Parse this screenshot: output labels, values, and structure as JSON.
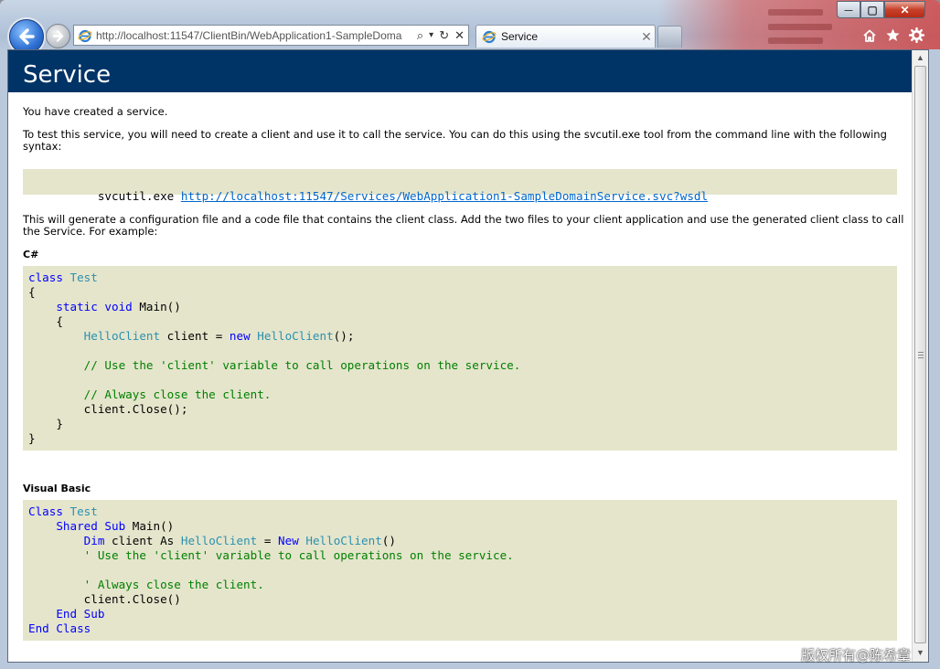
{
  "browser": {
    "address_url": "http://localhost:11547/ClientBin/WebApplication1-SampleDoma",
    "tab_title": "Service",
    "tab_close": "✕",
    "search_glyph": "⌕",
    "dropdown_glyph": "▾",
    "refresh_glyph": "↻",
    "stop_glyph": "✕"
  },
  "window_controls": {
    "minimize": "—",
    "maximize": "▢",
    "close": "✕"
  },
  "icons": {
    "back": "back-arrow-icon",
    "forward": "forward-arrow-icon",
    "home": "home-icon",
    "favorites": "favorites-star-icon",
    "tools": "tools-gear-icon",
    "page": "ie-page-icon"
  },
  "page": {
    "heading": "Service",
    "intro": "You have created a service.",
    "instructions": "To test this service, you will need to create a client and use it to call the service. You can do this using the svcutil.exe tool from the command line with the following syntax:",
    "svcutil_cmd": "svcutil.exe",
    "wsdl_url": "http://localhost:11547/Services/WebApplication1-SampleDomainService.svc?wsdl",
    "generate_note": "This will generate a configuration file and a code file that contains the client class. Add the two files to your client application and use the generated client class to call the Service. For example:",
    "csharp_label": "C#",
    "vb_label": "Visual Basic"
  },
  "csharp": {
    "l1_kw": "class",
    "l1_ty": "Test",
    "l2": "{",
    "l3_kw": "static void",
    "l3_rest": "Main()",
    "l4": "{",
    "l5_ty1": "HelloClient",
    "l5_mid": "client = ",
    "l5_kw": "new",
    "l5_ty2": "HelloClient",
    "l5_end": "();",
    "l6_cm": "// Use the 'client' variable to call operations on the service.",
    "l7_cm": "// Always close the client.",
    "l8": "client.Close();",
    "l9": "}",
    "l10": "}"
  },
  "vb": {
    "l1_kw": "Class",
    "l1_ty": "Test",
    "l2_kw": "Shared Sub",
    "l2_rest": "Main()",
    "l3_kw1": "Dim",
    "l3_mid": "client As",
    "l3_ty1": "HelloClient",
    "l3_eq": "=",
    "l3_kw2": "New",
    "l3_ty2": "HelloClient",
    "l3_end": "()",
    "l4_cm": "' Use the 'client' variable to call operations on the service.",
    "l5_cm": "' Always close the client.",
    "l6": "client.Close()",
    "l7_kw": "End Sub",
    "l8_kw": "End Class"
  },
  "watermark": "版权所有@陈希章",
  "colors": {
    "heading_band": "#003366",
    "code_bg": "#e5e5cc",
    "keyword": "#0000ff",
    "type": "#2b91af",
    "comment": "#008000"
  }
}
